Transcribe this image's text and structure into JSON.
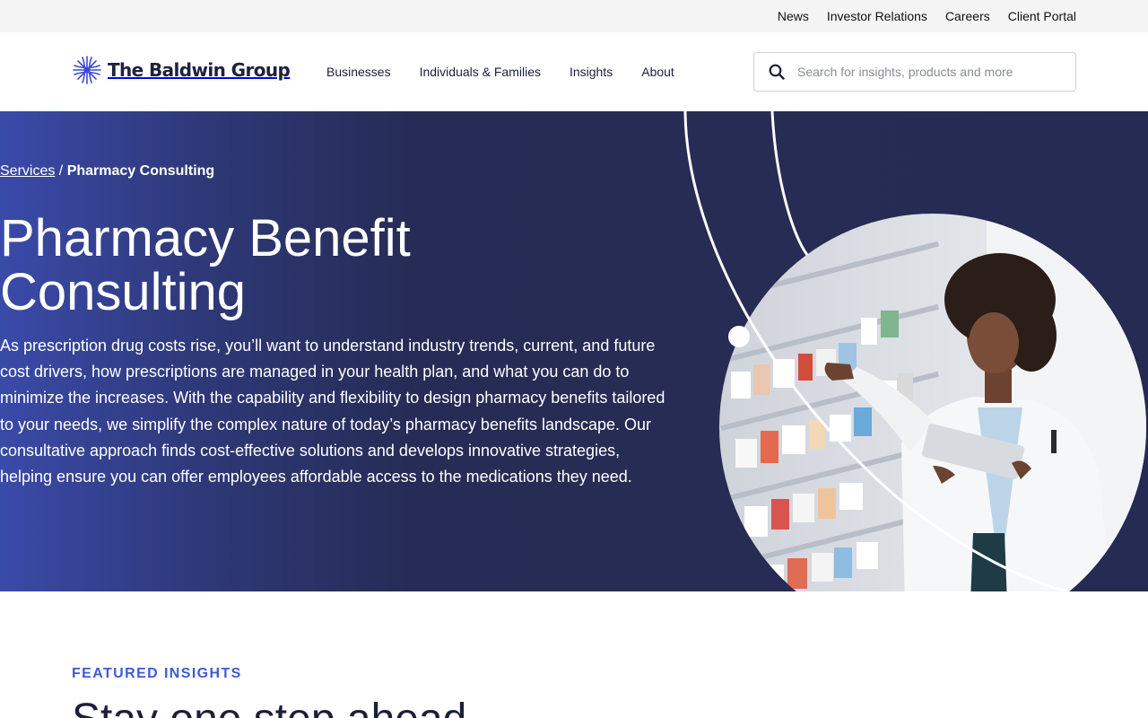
{
  "utility_nav": {
    "items": [
      "News",
      "Investor Relations",
      "Careers",
      "Client Portal"
    ]
  },
  "header": {
    "logo_text": "The Baldwin Group",
    "nav": [
      "Businesses",
      "Individuals & Families",
      "Insights",
      "About"
    ],
    "search": {
      "placeholder": "Search for insights, products and more",
      "value": ""
    }
  },
  "hero": {
    "breadcrumb": {
      "parent": "Services",
      "separator": " / ",
      "current": "Pharmacy Consulting"
    },
    "title": "Pharmacy Benefit Consulting",
    "body": "As prescription drug costs rise, you’ll want to understand industry trends, current, and future cost drivers, how prescriptions are managed in your health plan, and what you can do to minimize the increases. With the capability and flexibility to design pharmacy benefits tailored to your needs, we simplify the complex nature of today’s pharmacy benefits landscape. Our consultative approach finds cost-effective solutions and develops innovative strategies, helping ensure you can offer employees affordable access to the medications they need."
  },
  "featured": {
    "eyebrow": "FEATURED INSIGHTS",
    "heading": "Stay one step ahead"
  },
  "colors": {
    "accent": "#3f5bd9",
    "hero_dark": "#252b52",
    "hero_light": "#3a4aa8",
    "utility_bg": "#f4f4f4"
  },
  "icons": [
    "baldwin-logo-icon",
    "search-icon"
  ]
}
